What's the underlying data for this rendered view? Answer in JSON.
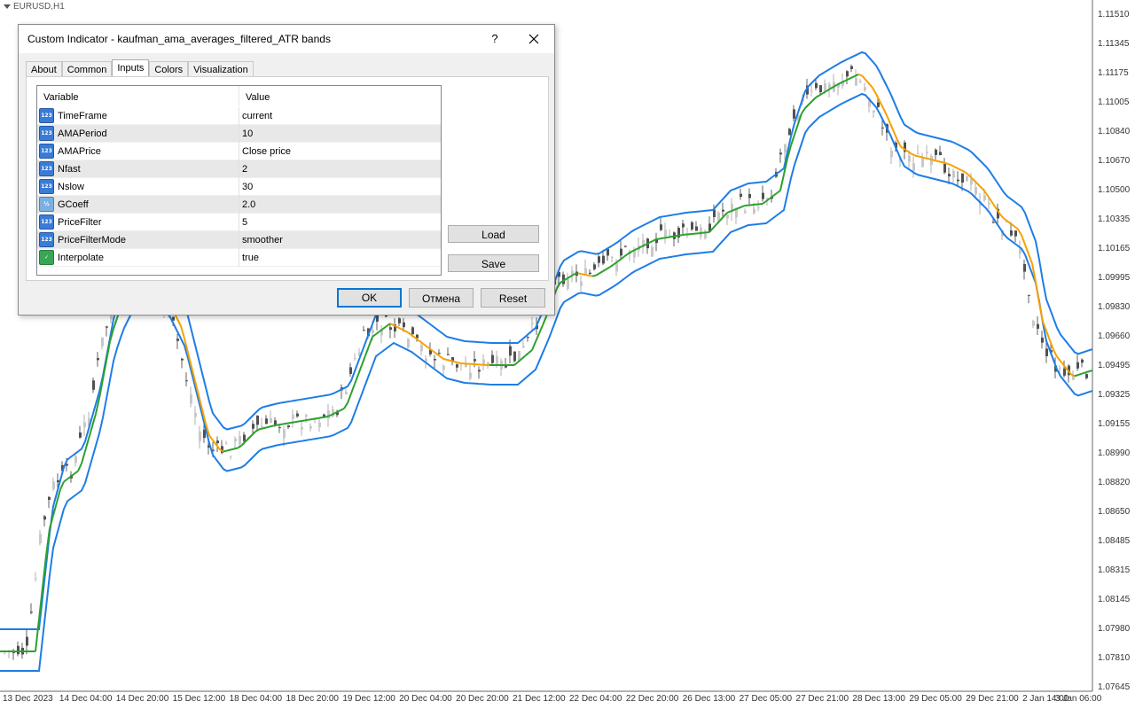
{
  "chart": {
    "symbol_label": "EURUSD,H1",
    "price_levels": [
      "1.11510",
      "1.11345",
      "1.11175",
      "1.11005",
      "1.10840",
      "1.10670",
      "1.10500",
      "1.10335",
      "1.10165",
      "1.09995",
      "1.09830",
      "1.09660",
      "1.09495",
      "1.09325",
      "1.09155",
      "1.08990",
      "1.08820",
      "1.08650",
      "1.08485",
      "1.08315",
      "1.08145",
      "1.07980",
      "1.07810",
      "1.07645"
    ],
    "time_labels": [
      "13 Dec 2023",
      "14 Dec 04:00",
      "14 Dec 20:00",
      "15 Dec 12:00",
      "18 Dec 04:00",
      "18 Dec 20:00",
      "19 Dec 12:00",
      "20 Dec 04:00",
      "20 Dec 20:00",
      "21 Dec 12:00",
      "22 Dec 04:00",
      "22 Dec 20:00",
      "26 Dec 13:00",
      "27 Dec 05:00",
      "27 Dec 21:00",
      "28 Dec 13:00",
      "29 Dec 05:00",
      "29 Dec 21:00",
      "2 Jan 14:00",
      "3 Jan 06:00"
    ],
    "colors": {
      "band": "#1e7de6",
      "ama_up": "#2ca02c",
      "ama_down": "#f5a000",
      "candle_up": "#c8c8c8",
      "candle_down": "#505050"
    }
  },
  "dialog": {
    "title": "Custom Indicator - kaufman_ama_averages_filtered_ATR bands",
    "help_label": "?",
    "tabs": [
      {
        "label": "About"
      },
      {
        "label": "Common"
      },
      {
        "label": "Inputs"
      },
      {
        "label": "Colors"
      },
      {
        "label": "Visualization"
      }
    ],
    "active_tab": "Inputs",
    "columns": {
      "variable": "Variable",
      "value": "Value"
    },
    "inputs": [
      {
        "name": "TimeFrame",
        "value": "current",
        "icon": "123"
      },
      {
        "name": "AMAPeriod",
        "value": "10",
        "icon": "123"
      },
      {
        "name": "AMAPrice",
        "value": "Close price",
        "icon": "123"
      },
      {
        "name": "Nfast",
        "value": "2",
        "icon": "123"
      },
      {
        "name": "Nslow",
        "value": "30",
        "icon": "123"
      },
      {
        "name": "GCoeff",
        "value": "2.0",
        "icon": "½"
      },
      {
        "name": "PriceFilter",
        "value": "5",
        "icon": "123"
      },
      {
        "name": "PriceFilterMode",
        "value": "smoother",
        "icon": "123"
      },
      {
        "name": "Interpolate",
        "value": "true",
        "icon": "bool"
      }
    ],
    "buttons": {
      "load": "Load",
      "save": "Save",
      "ok": "OK",
      "cancel": "Отмена",
      "reset": "Reset"
    }
  }
}
